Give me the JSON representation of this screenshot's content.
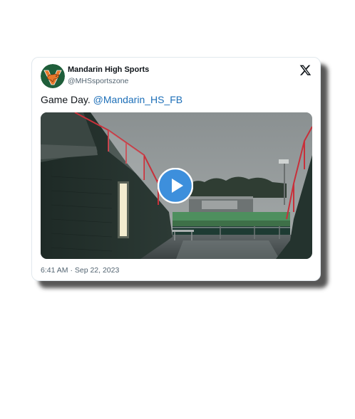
{
  "tweet": {
    "display_name": "Mandarin High Sports",
    "handle": "@MHSsportszone",
    "text": "Game Day.",
    "mention": "@Mandarin_HS_FB",
    "timestamp": "6:41 AM · Sep 22, 2023"
  },
  "icons": {
    "platform_logo": "x-logo-icon",
    "play": "play-icon",
    "avatar": "mustang-logo"
  },
  "colors": {
    "link": "#1d6fb8",
    "play_button": "#3d8fdc",
    "avatar_green": "#1f5e3a",
    "avatar_orange": "#e8782a",
    "stadium_railing": "#c8303a"
  }
}
